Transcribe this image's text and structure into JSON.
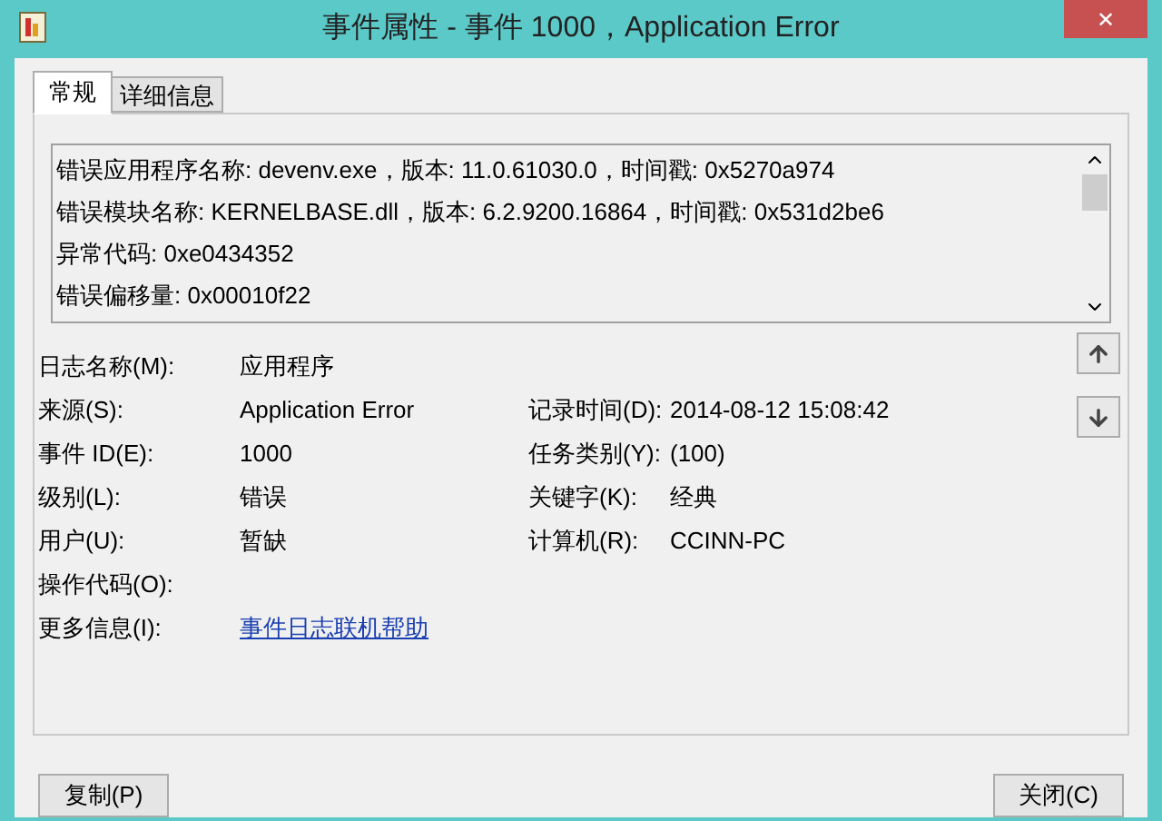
{
  "window": {
    "title": "事件属性 - 事件 1000，Application Error",
    "close": "✕"
  },
  "tabs": [
    {
      "label": "常规",
      "selected": true
    },
    {
      "label": "详细信息",
      "selected": false
    }
  ],
  "description": [
    "错误应用程序名称: devenv.exe，版本: 11.0.61030.0，时间戳: 0x5270a974",
    "错误模块名称: KERNELBASE.dll，版本: 6.2.9200.16864，时间戳: 0x531d2be6",
    "异常代码: 0xe0434352",
    "错误偏移量: 0x00010f22"
  ],
  "fields": [
    {
      "label": "日志名称(M):",
      "value": "应用程序"
    },
    {
      "label": "来源(S):",
      "value": "Application Error",
      "label_2": "记录时间(D):",
      "value_2": "2014-08-12 15:08:42"
    },
    {
      "label": "事件 ID(E):",
      "value": "1000",
      "label_2": "任务类别(Y):",
      "value_2": "(100)"
    },
    {
      "label": "级别(L):",
      "value": "错误",
      "label_2": "关键字(K):",
      "value_2": "经典"
    },
    {
      "label": "用户(U):",
      "value": "暂缺",
      "label_2": "计算机(R):",
      "value_2": "CCINN-PC"
    },
    {
      "label": "操作代码(O):"
    },
    {
      "label": "更多信息(I):",
      "link": "事件日志联机帮助"
    }
  ],
  "buttons": {
    "copy": "复制(P)",
    "close": "关闭(C)"
  }
}
